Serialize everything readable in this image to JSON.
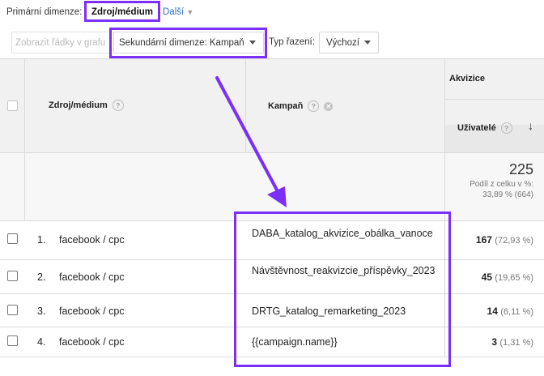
{
  "top": {
    "primary_label": "Primární dimenze:",
    "primary_selected": "Zdroj/médium",
    "more": "Další"
  },
  "controls": {
    "show_rows": "Zobrazit řádky v grafu",
    "secondary": "Sekundární dimenze: Kampaň",
    "sort_type_label": "Typ řazení:",
    "sort_value": "Výchozí"
  },
  "table": {
    "group_header": "Akvizice",
    "col_source": "Zdroj/médium",
    "col_campaign": "Kampaň",
    "col_users": "Uživatelé",
    "total_value": "225",
    "total_line1": "Podíl z celku v %:",
    "total_line2": "33,89 % (664)",
    "rows": [
      {
        "num": "1.",
        "source": "facebook / cpc",
        "campaign": "DABA_katalog_akvizice_obálka_vanoce",
        "value": "167",
        "pct": "(72,93 %)"
      },
      {
        "num": "2.",
        "source": "facebook / cpc",
        "campaign": "Návštěvnost_reakvizcie_příspěvky_2023",
        "value": "45",
        "pct": "(19,65 %)"
      },
      {
        "num": "3.",
        "source": "facebook / cpc",
        "campaign": "DRTG_katalog_remarketing_2023",
        "value": "14",
        "pct": "(6,11 %)"
      },
      {
        "num": "4.",
        "source": "facebook / cpc",
        "campaign": "{{campaign.name}}",
        "value": "3",
        "pct": "(1,31 %)"
      }
    ]
  },
  "colors": {
    "annotation": "#7b2ff7",
    "link": "#2a6ec6",
    "header_bg": "#f1f1f1"
  }
}
